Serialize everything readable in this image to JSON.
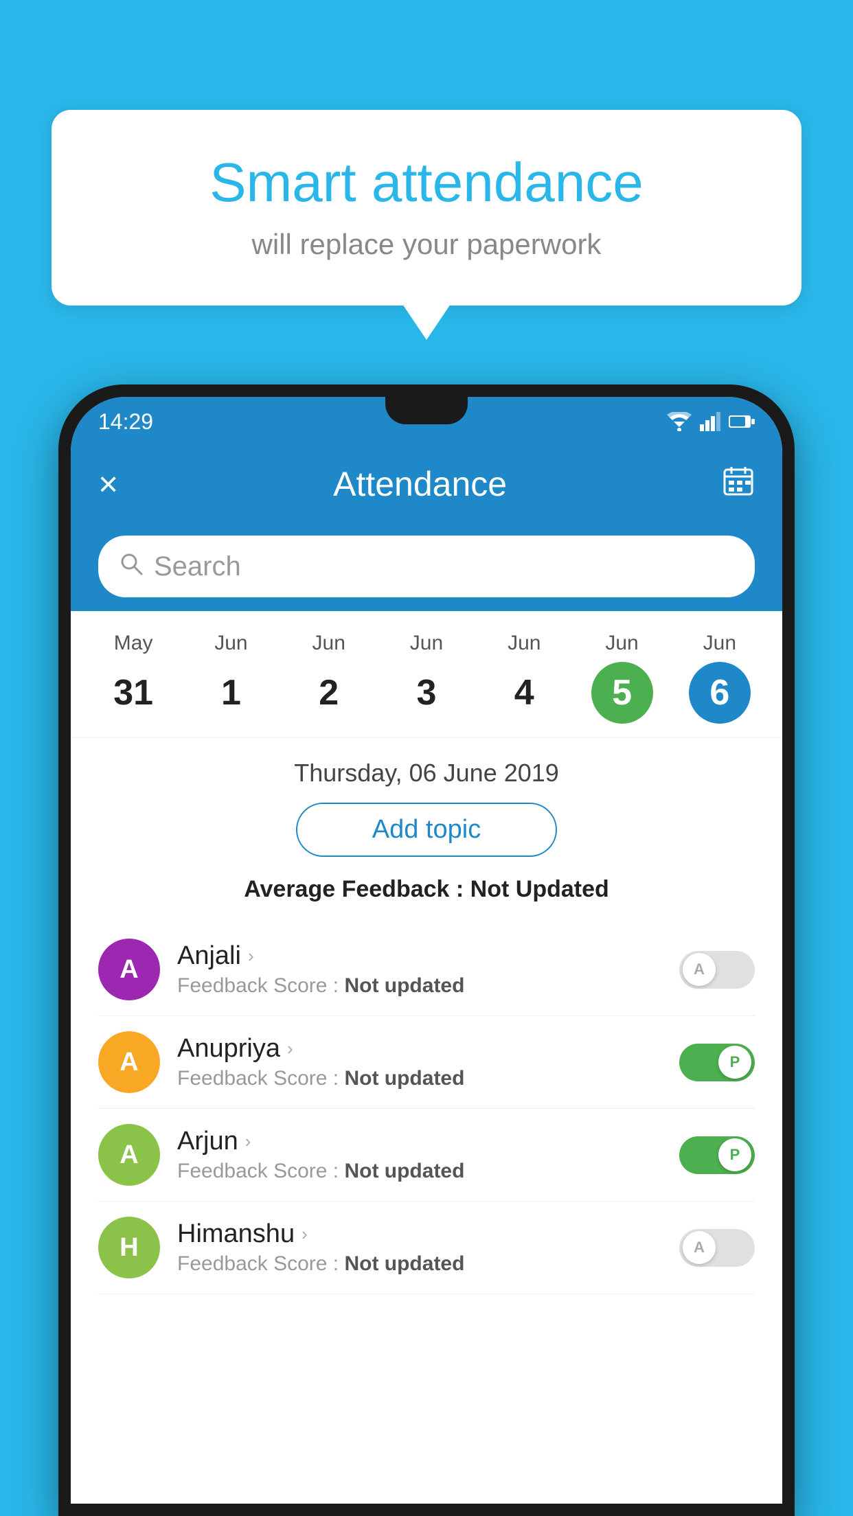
{
  "background_color": "#29b6e8",
  "speech_bubble": {
    "title": "Smart attendance",
    "subtitle": "will replace your paperwork"
  },
  "status_bar": {
    "time": "14:29"
  },
  "app_bar": {
    "close_label": "×",
    "title": "Attendance",
    "calendar_icon": "📅"
  },
  "search": {
    "placeholder": "Search"
  },
  "calendar": {
    "days": [
      {
        "month": "May",
        "date": "31",
        "type": "normal"
      },
      {
        "month": "Jun",
        "date": "1",
        "type": "normal"
      },
      {
        "month": "Jun",
        "date": "2",
        "type": "normal"
      },
      {
        "month": "Jun",
        "date": "3",
        "type": "normal"
      },
      {
        "month": "Jun",
        "date": "4",
        "type": "normal"
      },
      {
        "month": "Jun",
        "date": "5",
        "type": "today"
      },
      {
        "month": "Jun",
        "date": "6",
        "type": "selected"
      }
    ]
  },
  "content": {
    "date_header": "Thursday, 06 June 2019",
    "add_topic_label": "Add topic",
    "avg_feedback_label": "Average Feedback : ",
    "avg_feedback_value": "Not Updated",
    "students": [
      {
        "name": "Anjali",
        "avatar_letter": "A",
        "avatar_color": "#9c27b0",
        "feedback_label": "Feedback Score : ",
        "feedback_value": "Not updated",
        "toggle": "off",
        "toggle_label": "A"
      },
      {
        "name": "Anupriya",
        "avatar_letter": "A",
        "avatar_color": "#f9a825",
        "feedback_label": "Feedback Score : ",
        "feedback_value": "Not updated",
        "toggle": "on",
        "toggle_label": "P"
      },
      {
        "name": "Arjun",
        "avatar_letter": "A",
        "avatar_color": "#8bc34a",
        "feedback_label": "Feedback Score : ",
        "feedback_value": "Not updated",
        "toggle": "on",
        "toggle_label": "P"
      },
      {
        "name": "Himanshu",
        "avatar_letter": "H",
        "avatar_color": "#8bc34a",
        "feedback_label": "Feedback Score : ",
        "feedback_value": "Not updated",
        "toggle": "off",
        "toggle_label": "A"
      }
    ]
  }
}
